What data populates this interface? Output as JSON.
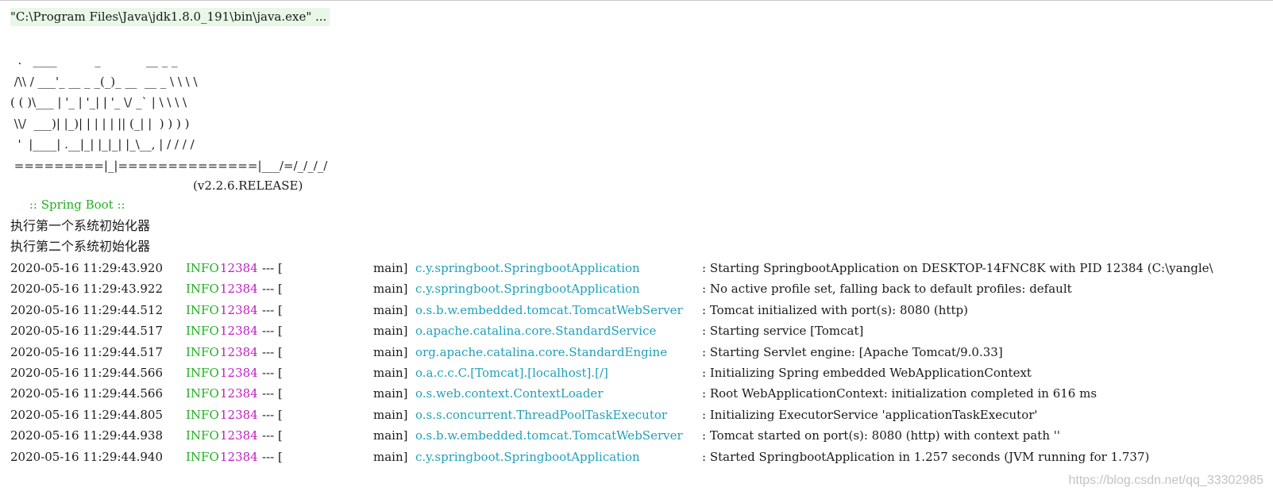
{
  "console": {
    "command": "\"C:\\Program Files\\Java\\jdk1.8.0_191\\bin\\java.exe\" ...",
    "banner_lines": [
      "  .   ____          _            __ _ _",
      " /\\\\ / ___'_ __ _ _(_)_ __  __ _ \\ \\ \\ \\",
      "( ( )\\___ | '_ | '_| | '_ \\/ _` | \\ \\ \\ \\",
      " \\\\/  ___)| |_)| | | | | || (_| |  ) ) ) )",
      "  '  |____| .__|_| |_|_| |_\\__, | / / / /",
      " =========|_|==============|___/=/_/_/_/"
    ],
    "spring_label": " :: Spring Boot :: ",
    "spring_version": "(v2.2.6.RELEASE)",
    "init_lines": [
      "执行第一个系统初始化器",
      "执行第二个系统初始化器"
    ],
    "log_rows": [
      {
        "ts": "2020-05-16 11:29:43.920",
        "level": "INFO",
        "pid": "12384",
        "sep": "--- [",
        "thread": "main]",
        "logger": "c.y.springboot.SpringbootApplication",
        "msg": ": Starting SpringbootApplication on DESKTOP-14FNC8K with PID 12384 (C:\\yangle\\"
      },
      {
        "ts": "2020-05-16 11:29:43.922",
        "level": "INFO",
        "pid": "12384",
        "sep": "--- [",
        "thread": "main]",
        "logger": "c.y.springboot.SpringbootApplication",
        "msg": ": No active profile set, falling back to default profiles: default"
      },
      {
        "ts": "2020-05-16 11:29:44.512",
        "level": "INFO",
        "pid": "12384",
        "sep": "--- [",
        "thread": "main]",
        "logger": "o.s.b.w.embedded.tomcat.TomcatWebServer",
        "msg": ": Tomcat initialized with port(s): 8080 (http)"
      },
      {
        "ts": "2020-05-16 11:29:44.517",
        "level": "INFO",
        "pid": "12384",
        "sep": "--- [",
        "thread": "main]",
        "logger": "o.apache.catalina.core.StandardService",
        "msg": ": Starting service [Tomcat]"
      },
      {
        "ts": "2020-05-16 11:29:44.517",
        "level": "INFO",
        "pid": "12384",
        "sep": "--- [",
        "thread": "main]",
        "logger": "org.apache.catalina.core.StandardEngine",
        "msg": ": Starting Servlet engine: [Apache Tomcat/9.0.33]"
      },
      {
        "ts": "2020-05-16 11:29:44.566",
        "level": "INFO",
        "pid": "12384",
        "sep": "--- [",
        "thread": "main]",
        "logger": "o.a.c.c.C.[Tomcat].[localhost].[/]",
        "msg": ": Initializing Spring embedded WebApplicationContext"
      },
      {
        "ts": "2020-05-16 11:29:44.566",
        "level": "INFO",
        "pid": "12384",
        "sep": "--- [",
        "thread": "main]",
        "logger": "o.s.web.context.ContextLoader",
        "msg": ": Root WebApplicationContext: initialization completed in 616 ms"
      },
      {
        "ts": "2020-05-16 11:29:44.805",
        "level": "INFO",
        "pid": "12384",
        "sep": "--- [",
        "thread": "main]",
        "logger": "o.s.s.concurrent.ThreadPoolTaskExecutor",
        "msg": ": Initializing ExecutorService 'applicationTaskExecutor'"
      },
      {
        "ts": "2020-05-16 11:29:44.938",
        "level": "INFO",
        "pid": "12384",
        "sep": "--- [",
        "thread": "main]",
        "logger": "o.s.b.w.embedded.tomcat.TomcatWebServer",
        "msg": ": Tomcat started on port(s): 8080 (http) with context path ''"
      },
      {
        "ts": "2020-05-16 11:29:44.940",
        "level": "INFO",
        "pid": "12384",
        "sep": "--- [",
        "thread": "main]",
        "logger": "c.y.springboot.SpringbootApplication",
        "msg": ": Started SpringbootApplication in 1.257 seconds (JVM running for 1.737)"
      }
    ],
    "watermark": "https://blog.csdn.net/qq_33302985"
  },
  "colors": {
    "level": "#22b022",
    "pid": "#c020c0",
    "logger": "#20a0b8",
    "spring_label": "#22b022",
    "command_bg": "#e8f7e8"
  }
}
